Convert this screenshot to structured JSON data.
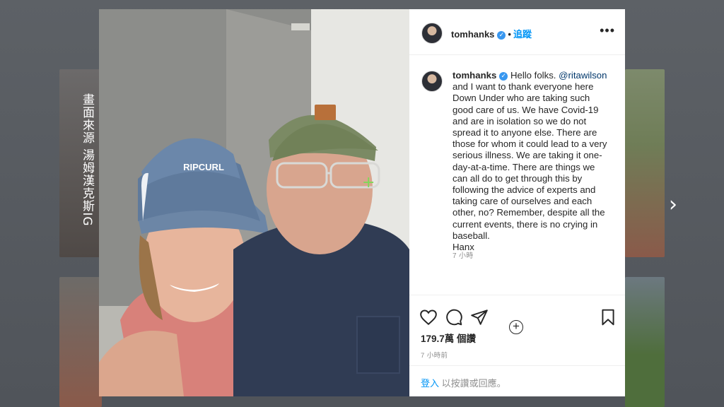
{
  "caption_vertical": "畫面來源 湯姆漢克斯IG",
  "post": {
    "username": "tomhanks",
    "verified": true,
    "follow_label": "追蹤",
    "more_label": "•••",
    "caption_user": "tomhanks",
    "caption_greeting": " Hello folks. ",
    "caption_mention": "@ritawilson",
    "caption_body": " and I want to thank everyone here Down Under who are taking such good care of us. We have Covid-19 and are in isolation so we do not spread it to anyone else. There are those for whom it could lead to a very serious illness. We are taking it one-day-at-a-time. There are things we can all do to get through this by following the advice of experts and taking care of ourselves and each other, no? Remember, despite all the current events, there is no crying in baseball.",
    "caption_signoff": "Hanx",
    "caption_time": "7 小時",
    "likes_label": "179.7萬 個讚",
    "posted_time": "7 小時前",
    "comment_login": "登入",
    "comment_placeholder": " 以按讚或回應。"
  },
  "photo": {
    "left_cap_text": "RIPCURL"
  },
  "icons": {
    "heart": "heart-icon",
    "comment": "comment-icon",
    "share": "share-icon",
    "save": "bookmark-icon",
    "load_more": "plus-circle-icon",
    "next": "chevron-right-icon",
    "verified": "verified-badge-icon"
  },
  "colors": {
    "link_blue": "#0095f6",
    "verified_blue": "#3897f0",
    "mention": "#00376b",
    "muted": "#8e8e8e"
  }
}
